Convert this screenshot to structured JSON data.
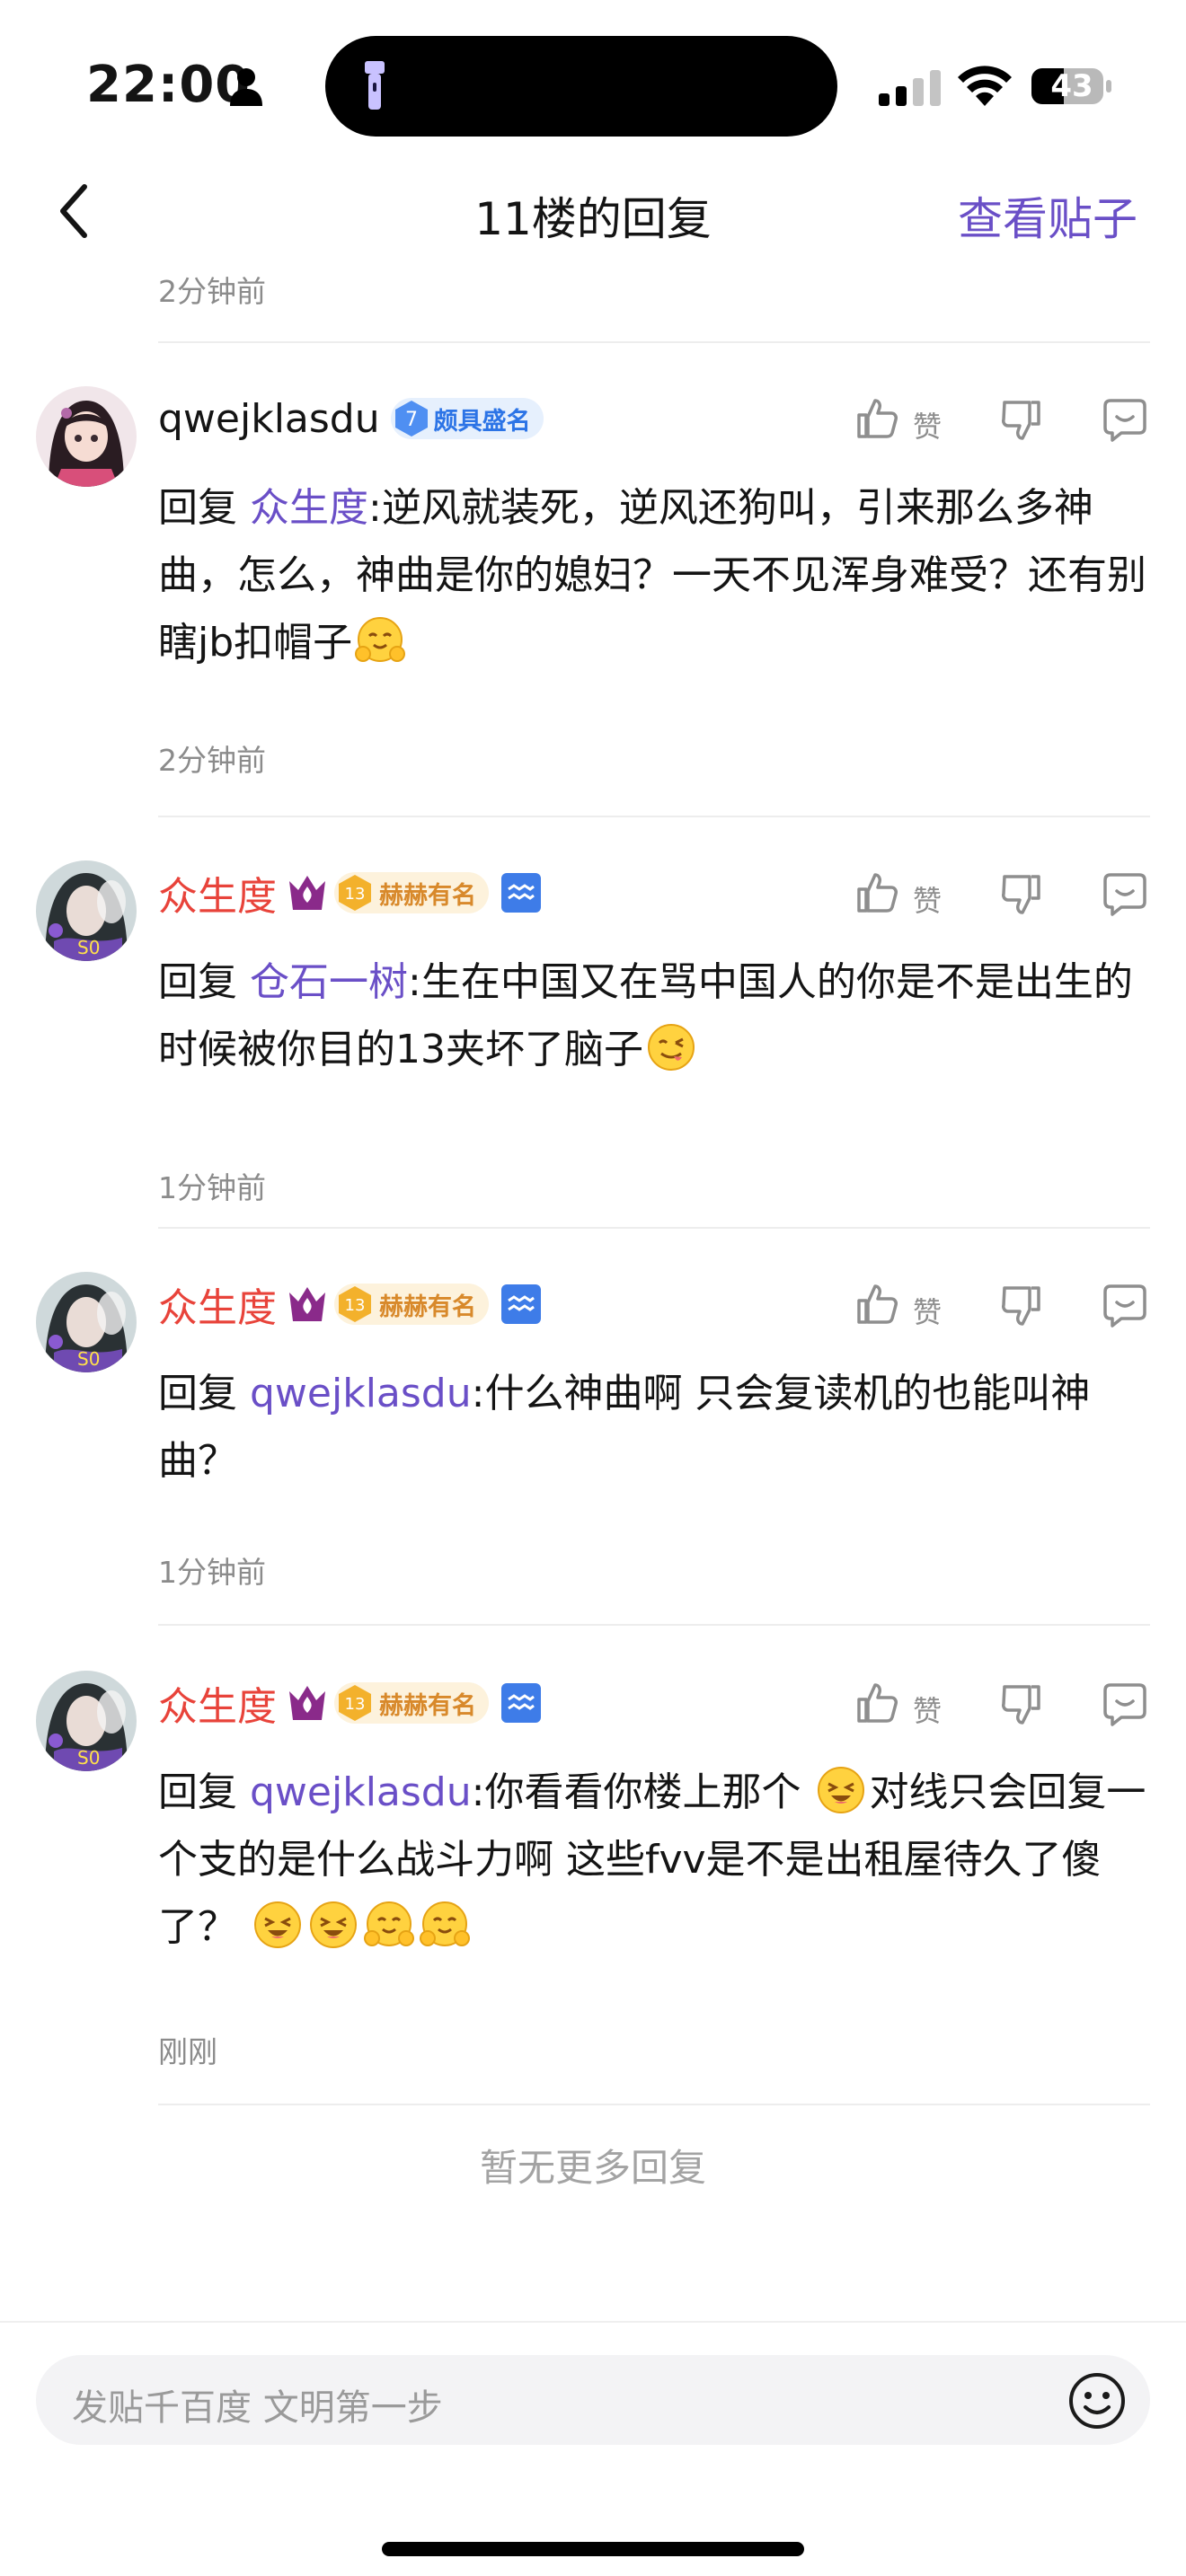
{
  "status_bar": {
    "time": "22:00",
    "battery_level": "43",
    "icons": [
      "person-icon",
      "flashlight-icon",
      "signal-icon",
      "wifi-icon",
      "battery-icon"
    ]
  },
  "nav": {
    "title": "11楼的回复",
    "view_post": "查看贴子",
    "back_icon": "chevron-left-icon"
  },
  "first_time": "2分钟前",
  "comments": [
    {
      "username": "qwejklasdu",
      "badge_level": "7",
      "badge_text": "颇具盛名",
      "like_label": "赞",
      "reply_prefix": "回复",
      "mention": "众生度",
      "text": ":逆风就装死，逆风还狗叫，引来那么多神曲，怎么，神曲是你的媳妇？一天不见浑身难受？还有别瞎jb扣帽子",
      "emojis": [
        "hug-emoji"
      ],
      "time": "2分钟前"
    },
    {
      "username": "众生度",
      "badge_level": "13",
      "badge_text": "赫赫有名",
      "like_label": "赞",
      "reply_prefix": "回复",
      "mention": "仓石一树",
      "text": ":生在中国又在骂中国人的你是不是出生的时候被你目的13夹坏了脑子",
      "emojis": [
        "yum-emoji"
      ],
      "time": "1分钟前"
    },
    {
      "username": "众生度",
      "badge_level": "13",
      "badge_text": "赫赫有名",
      "like_label": "赞",
      "reply_prefix": "回复",
      "mention": "qwejklasdu",
      "text": ":什么神曲啊 只会复读机的也能叫神曲？",
      "time": "1分钟前"
    },
    {
      "username": "众生度",
      "badge_level": "13",
      "badge_text": "赫赫有名",
      "like_label": "赞",
      "reply_prefix": "回复",
      "mention": "qwejklasdu",
      "text_a": ":你看看你楼上那个 ",
      "text_b": "对线只会回复一个支的是什么战斗力啊 这些fvv是不是出租屋待久了傻了？ ",
      "emojis": [
        "squint-emoji",
        "squint-emoji",
        "squint-emoji",
        "hug-emoji",
        "hug-emoji"
      ],
      "time": "刚刚"
    }
  ],
  "no_more": "暂无更多回复",
  "input": {
    "placeholder": "发贴千百度 文明第一步",
    "emoji_icon": "smile-icon"
  }
}
